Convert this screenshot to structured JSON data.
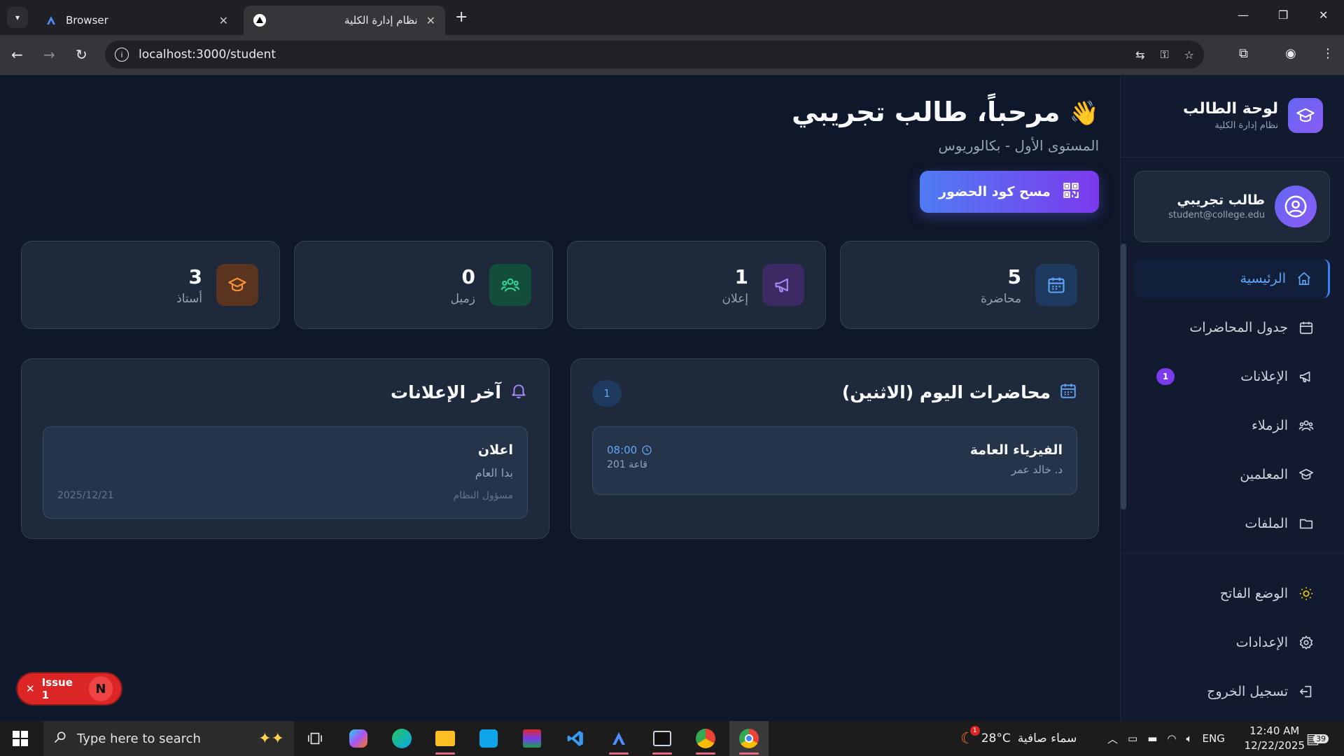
{
  "browser": {
    "tabs": [
      {
        "title": "Browser",
        "icon": "app-a-icon"
      },
      {
        "title": "نظام إدارة الكلية",
        "icon": "triangle-logo-icon"
      }
    ],
    "url": "localhost:3000/student"
  },
  "sidebar": {
    "brand_title": "لوحة الطالب",
    "brand_subtitle": "نظام إدارة الكلية",
    "user_name": "طالب تجريبي",
    "user_email": "student@college.edu",
    "nav": [
      {
        "label": "الرئيسية",
        "icon": "home-icon",
        "active": true
      },
      {
        "label": "جدول المحاضرات",
        "icon": "calendar-icon"
      },
      {
        "label": "الإعلانات",
        "icon": "megaphone-icon",
        "badge": "1"
      },
      {
        "label": "الزملاء",
        "icon": "users-icon"
      },
      {
        "label": "المعلمين",
        "icon": "graduation-cap-icon"
      },
      {
        "label": "الملفات",
        "icon": "folder-icon"
      }
    ],
    "bottom": [
      {
        "label": "الوضع الفاتح",
        "icon": "sun-icon"
      },
      {
        "label": "الإعدادات",
        "icon": "gear-icon"
      },
      {
        "label": "تسجيل الخروج",
        "icon": "logout-icon"
      }
    ]
  },
  "main": {
    "greeting": "مرحباً، طالب تجريبي",
    "greeting_emoji": "👋",
    "level": "المستوى الأول - بكالوريوس",
    "scan_button": "مسح كود الحضور",
    "stats": [
      {
        "value": "5",
        "label": "محاضرة",
        "icon": "calendar-icon"
      },
      {
        "value": "1",
        "label": "إعلان",
        "icon": "megaphone-icon"
      },
      {
        "value": "0",
        "label": "زميل",
        "icon": "users-icon"
      },
      {
        "value": "3",
        "label": "أستاذ",
        "icon": "graduation-cap-icon"
      }
    ],
    "today": {
      "title": "محاضرات اليوم (الاثنين)",
      "count": "1",
      "lecture": {
        "name": "الفيزياء العامة",
        "professor": "د. خالد عمر",
        "time": "08:00",
        "room": "قاعة 201"
      }
    },
    "announcements": {
      "title": "آخر الإعلانات",
      "item": {
        "title": "اعلان",
        "body": "بدا العام",
        "author": "مسؤول النظام",
        "date": "2025/12/21"
      }
    }
  },
  "issue_pill": {
    "label": "Issue 1",
    "letter": "N"
  },
  "taskbar": {
    "search_placeholder": "Type here to search",
    "weather_temp": "28°C",
    "weather_text": "سماء صافية",
    "weather_alert": "1",
    "language": "ENG",
    "time": "12:40 AM",
    "date": "12/22/2025",
    "notifications": "39"
  },
  "colors": {
    "accent": "#3b82f6",
    "purple": "#7c3aed",
    "background": "#0f172a",
    "card": "#1e293b"
  }
}
